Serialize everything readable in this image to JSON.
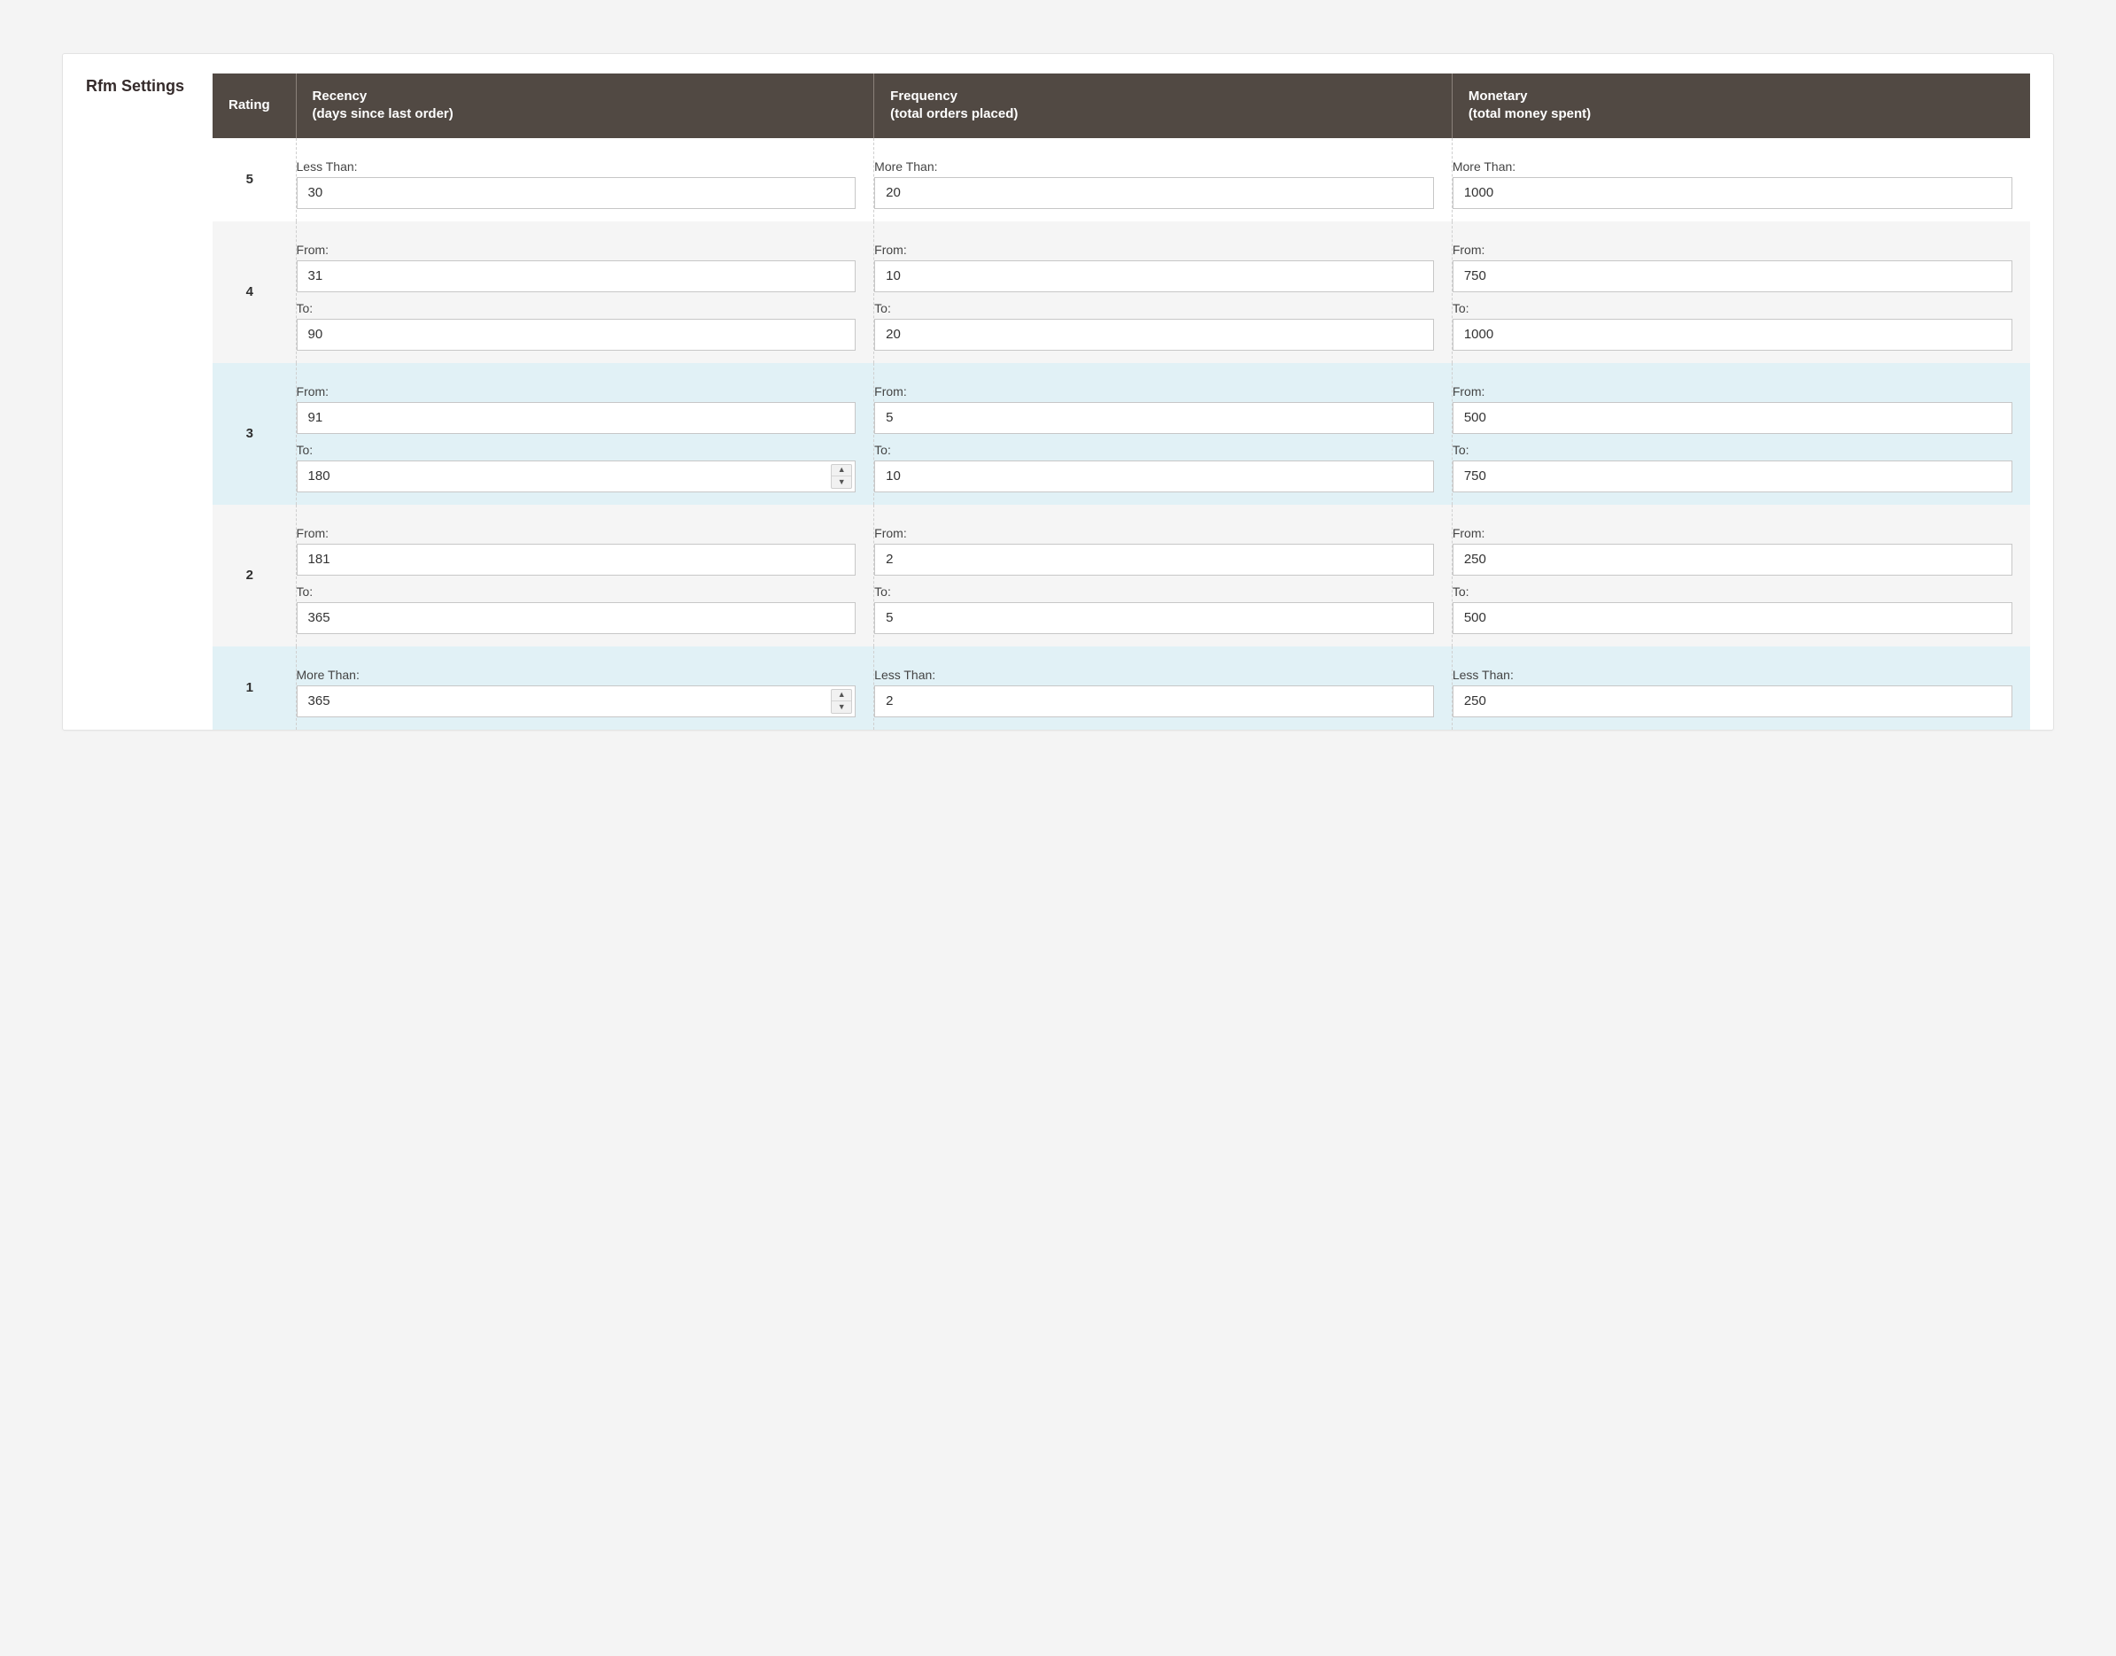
{
  "panel": {
    "title": "Rfm Settings"
  },
  "labels": {
    "less_than": "Less Than:",
    "more_than": "More Than:",
    "from": "From:",
    "to": "To:"
  },
  "table": {
    "headers": {
      "rating": "Rating",
      "recency": {
        "title": "Recency",
        "sub": "(days since last order)"
      },
      "frequency": {
        "title": "Frequency",
        "sub": "(total orders placed)"
      },
      "monetary": {
        "title": "Monetary",
        "sub": "(total money spent)"
      }
    },
    "rows": [
      {
        "rating": "5",
        "tone": "white",
        "recency": {
          "mode": "single",
          "label": "less_than",
          "value": "30",
          "spinner": false
        },
        "frequency": {
          "mode": "single",
          "label": "more_than",
          "value": "20",
          "spinner": false
        },
        "monetary": {
          "mode": "single",
          "label": "more_than",
          "value": "1000",
          "spinner": false
        }
      },
      {
        "rating": "4",
        "tone": "gray",
        "recency": {
          "mode": "range",
          "from": "31",
          "to": "90",
          "spinner_from": false,
          "spinner_to": false
        },
        "frequency": {
          "mode": "range",
          "from": "10",
          "to": "20",
          "spinner_from": false,
          "spinner_to": false
        },
        "monetary": {
          "mode": "range",
          "from": "750",
          "to": "1000",
          "spinner_from": false,
          "spinner_to": false
        }
      },
      {
        "rating": "3",
        "tone": "blue",
        "recency": {
          "mode": "range",
          "from": "91",
          "to": "180",
          "spinner_from": false,
          "spinner_to": true
        },
        "frequency": {
          "mode": "range",
          "from": "5",
          "to": "10",
          "spinner_from": false,
          "spinner_to": false
        },
        "monetary": {
          "mode": "range",
          "from": "500",
          "to": "750",
          "spinner_from": false,
          "spinner_to": false
        }
      },
      {
        "rating": "2",
        "tone": "gray",
        "recency": {
          "mode": "range",
          "from": "181",
          "to": "365",
          "spinner_from": false,
          "spinner_to": false
        },
        "frequency": {
          "mode": "range",
          "from": "2",
          "to": "5",
          "spinner_from": false,
          "spinner_to": false
        },
        "monetary": {
          "mode": "range",
          "from": "250",
          "to": "500",
          "spinner_from": false,
          "spinner_to": false
        }
      },
      {
        "rating": "1",
        "tone": "blue",
        "recency": {
          "mode": "single",
          "label": "more_than",
          "value": "365",
          "spinner": true
        },
        "frequency": {
          "mode": "single",
          "label": "less_than",
          "value": "2",
          "spinner": false
        },
        "monetary": {
          "mode": "single",
          "label": "less_than",
          "value": "250",
          "spinner": false
        }
      }
    ]
  }
}
